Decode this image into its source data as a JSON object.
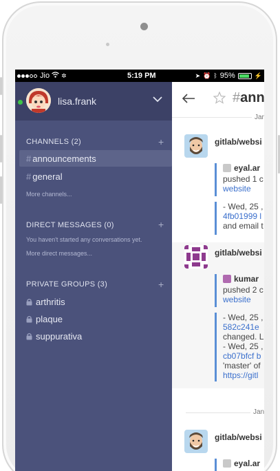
{
  "status_bar": {
    "carrier": "Jio",
    "time": "5:19 PM",
    "battery": "95%"
  },
  "user": {
    "name": "lisa.frank"
  },
  "sidebar": {
    "channels_title": "CHANNELS (2)",
    "channels": [
      {
        "label": "announcements"
      },
      {
        "label": "general"
      }
    ],
    "more_channels": "More channels...",
    "dm_title": "DIRECT MESSAGES (0)",
    "dm_empty": "You haven't started any conversations yet.",
    "more_dm": "More direct messages...",
    "groups_title": "PRIVATE GROUPS (3)",
    "groups": [
      {
        "label": "arthritis"
      },
      {
        "label": "plaque"
      },
      {
        "label": "suppurativa"
      }
    ]
  },
  "main": {
    "channel_title": "ann",
    "date_top": "Jan",
    "messages": [
      {
        "author": "gitlab/websi",
        "attach_user": "eyal.ar",
        "line1": "pushed 1 c",
        "line2": "website",
        "detail": [
          "- Wed, 25 ,",
          "4fb01999 l",
          "and email t"
        ]
      },
      {
        "author": "gitlab/websi",
        "attach_user": "kumar",
        "line1": "pushed 2 c",
        "line2": "website",
        "detail": [
          "- Wed, 25 ,",
          "582c241e",
          "changed. L",
          "- Wed, 25 ,",
          "cb07bfcf b",
          "'master' of",
          "https://gitl"
        ]
      },
      {
        "author": "gitlab/websi",
        "attach_user": "eyal.ar"
      }
    ],
    "date_sep": "Jan"
  },
  "colors": {
    "sidebar_bg": "#4b527b",
    "accent": "#5a8fd6",
    "link": "#3a6fcc"
  }
}
